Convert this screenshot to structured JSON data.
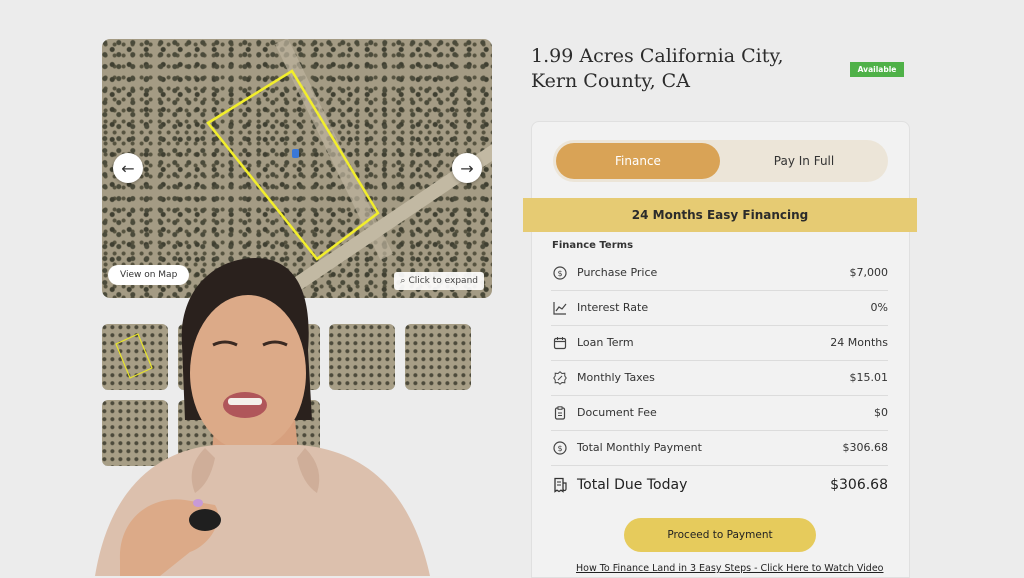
{
  "gallery": {
    "view_on_map": "View on Map",
    "click_to_expand": "Click to expand",
    "prev_icon": "arrow-left-icon",
    "next_icon": "arrow-right-icon",
    "thumbnail_count": 8
  },
  "listing": {
    "title": "1.99 Acres California City, Kern County, CA",
    "status_badge": "Available",
    "badge_color": "#4fb148"
  },
  "payment_toggle": {
    "options": [
      "Finance",
      "Pay In Full"
    ],
    "selected": "Finance",
    "accent_color": "#d9a356"
  },
  "financing": {
    "banner": "24 Months Easy Financing",
    "banner_color": "#e6cb73",
    "section_title": "Finance Terms",
    "rows": [
      {
        "icon": "dollar-circle-icon",
        "label": "Purchase Price",
        "value": "$7,000"
      },
      {
        "icon": "chart-line-icon",
        "label": "Interest Rate",
        "value": "0%"
      },
      {
        "icon": "calendar-icon",
        "label": "Loan Term",
        "value": "24 Months"
      },
      {
        "icon": "percent-badge-icon",
        "label": "Monthly Taxes",
        "value": "$15.01"
      },
      {
        "icon": "clipboard-icon",
        "label": "Document Fee",
        "value": "$0"
      },
      {
        "icon": "dollar-circle-icon",
        "label": "Total Monthly Payment",
        "value": "$306.68"
      }
    ],
    "total_label": "Total Due Today",
    "total_value": "$306.68"
  },
  "actions": {
    "proceed": "Proceed to Payment",
    "video_link": "How To Finance Land in 3 Easy Steps - Click Here to Watch Video"
  }
}
